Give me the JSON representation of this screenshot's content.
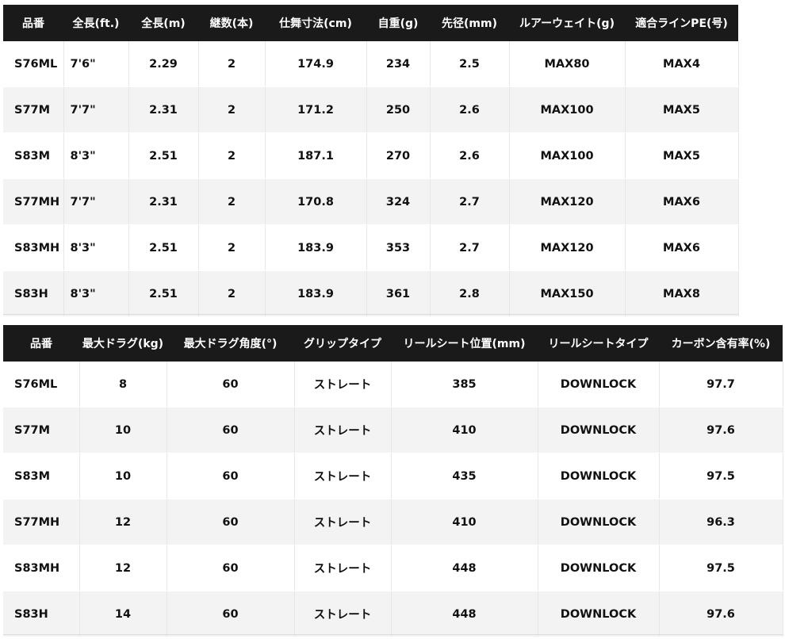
{
  "table1": {
    "headers": [
      "品番",
      "全長(ft.)",
      "全長(m)",
      "継数(本)",
      "仕舞寸法(cm)",
      "自重(g)",
      "先径(mm)",
      "ルアーウェイト(g)",
      "適合ラインPE(号)"
    ],
    "rows": [
      [
        "S76ML",
        "7'6\"",
        "2.29",
        "2",
        "174.9",
        "234",
        "2.5",
        "MAX80",
        "MAX4"
      ],
      [
        "S77M",
        "7'7\"",
        "2.31",
        "2",
        "171.2",
        "250",
        "2.6",
        "MAX100",
        "MAX5"
      ],
      [
        "S83M",
        "8'3\"",
        "2.51",
        "2",
        "187.1",
        "270",
        "2.6",
        "MAX100",
        "MAX5"
      ],
      [
        "S77MH",
        "7'7\"",
        "2.31",
        "2",
        "170.8",
        "324",
        "2.7",
        "MAX120",
        "MAX6"
      ],
      [
        "S83MH",
        "8'3\"",
        "2.51",
        "2",
        "183.9",
        "353",
        "2.7",
        "MAX120",
        "MAX6"
      ],
      [
        "S83H",
        "8'3\"",
        "2.51",
        "2",
        "183.9",
        "361",
        "2.8",
        "MAX150",
        "MAX8"
      ]
    ]
  },
  "table2": {
    "headers": [
      "品番",
      "最大ドラグ(kg)",
      "最大ドラグ角度(°)",
      "グリップタイプ",
      "リールシート位置(mm)",
      "リールシートタイプ",
      "カーボン含有率(%)"
    ],
    "rows": [
      [
        "S76ML",
        "8",
        "60",
        "ストレート",
        "385",
        "DOWNLOCK",
        "97.7"
      ],
      [
        "S77M",
        "10",
        "60",
        "ストレート",
        "410",
        "DOWNLOCK",
        "97.6"
      ],
      [
        "S83M",
        "10",
        "60",
        "ストレート",
        "435",
        "DOWNLOCK",
        "97.5"
      ],
      [
        "S77MH",
        "12",
        "60",
        "ストレート",
        "410",
        "DOWNLOCK",
        "96.3"
      ],
      [
        "S83MH",
        "12",
        "60",
        "ストレート",
        "448",
        "DOWNLOCK",
        "97.5"
      ],
      [
        "S83H",
        "14",
        "60",
        "ストレート",
        "448",
        "DOWNLOCK",
        "97.6"
      ]
    ]
  }
}
